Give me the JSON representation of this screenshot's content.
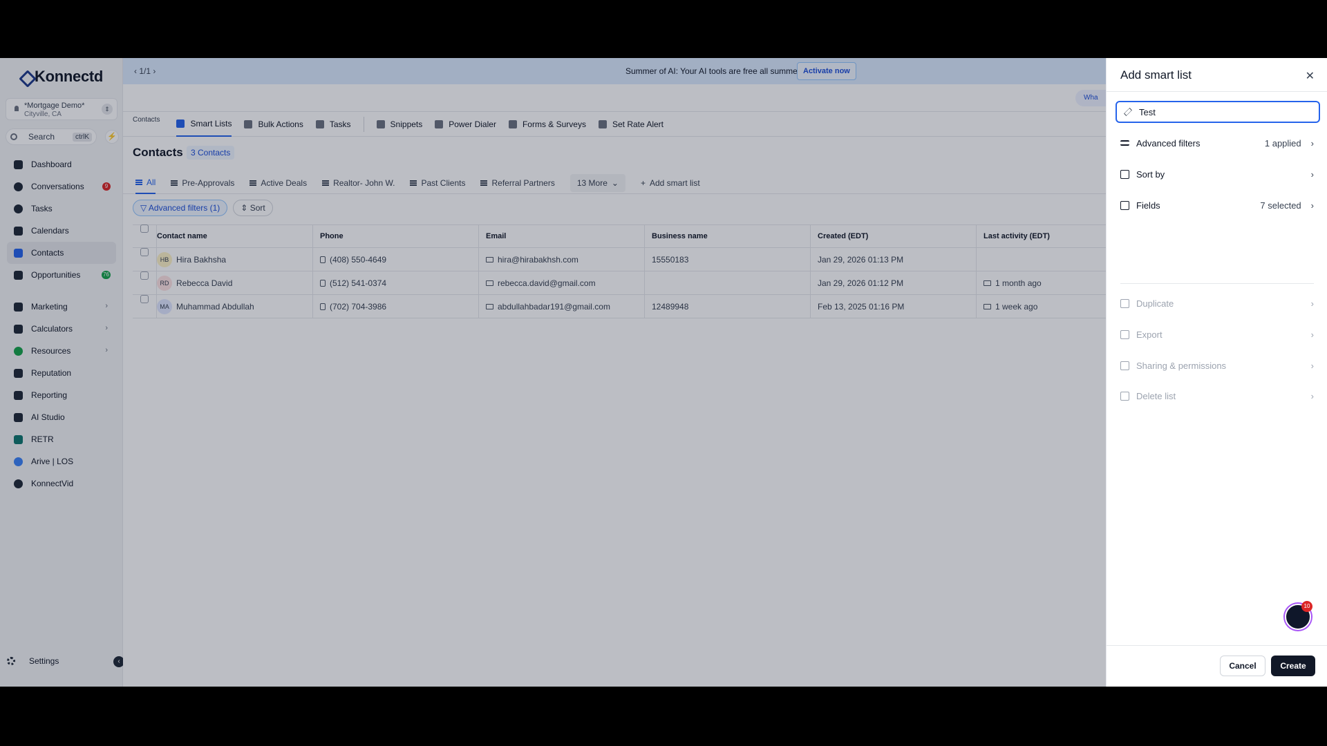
{
  "app": {
    "brand": "Konnectd"
  },
  "account": {
    "name": "*Mortgage Demo*",
    "location": "Cityville, CA"
  },
  "search": {
    "placeholder": "Search",
    "shortcut": "ctrlK"
  },
  "nav": {
    "items": [
      {
        "label": "Dashboard"
      },
      {
        "label": "Conversations",
        "badge": "9"
      },
      {
        "label": "Tasks"
      },
      {
        "label": "Calendars"
      },
      {
        "label": "Contacts"
      },
      {
        "label": "Opportunities",
        "badge": "76"
      },
      {
        "label": "Marketing"
      },
      {
        "label": "Calculators"
      },
      {
        "label": "Resources"
      },
      {
        "label": "Reputation"
      },
      {
        "label": "Reporting"
      },
      {
        "label": "AI Studio"
      },
      {
        "label": "RETR"
      },
      {
        "label": "Arive | LOS"
      },
      {
        "label": "KonnectVid"
      }
    ],
    "settings": "Settings"
  },
  "banner": {
    "pager": "1/1",
    "message": "Summer of AI: Your AI tools are free all summer.",
    "cta": "Activate now"
  },
  "topbar": {
    "whats_new": "Wha"
  },
  "subnav": {
    "crumb": "Contacts",
    "items": [
      "Smart Lists",
      "Bulk Actions",
      "Tasks",
      "Snippets",
      "Power Dialer",
      "Forms & Surveys",
      "Set Rate Alert"
    ]
  },
  "page": {
    "title": "Contacts",
    "count": "3 Contacts"
  },
  "tabs": [
    "All",
    "Pre-Approvals",
    "Active Deals",
    "Realtor- John W.",
    "Past Clients",
    "Referral Partners",
    "13 More",
    "Add smart list"
  ],
  "filters": {
    "advanced": "Advanced filters (1)",
    "sort": "Sort"
  },
  "table": {
    "headers": [
      "Contact name",
      "Phone",
      "Email",
      "Business name",
      "Created (EDT)",
      "Last activity (EDT)"
    ],
    "rows": [
      {
        "initials": "HB",
        "name": "Hira Bakhsha",
        "phone": "(408) 550-4649",
        "email": "hira@hirabakhsh.com",
        "business": "15550183",
        "created": "Jan 29, 2026 01:13 PM",
        "last": ""
      },
      {
        "initials": "RD",
        "name": "Rebecca David",
        "phone": "(512) 541-0374",
        "email": "rebecca.david@gmail.com",
        "business": "",
        "created": "Jan 29, 2026 01:12 PM",
        "last": "1 month ago"
      },
      {
        "initials": "MA",
        "name": "Muhammad Abdullah",
        "phone": "(702) 704-3986",
        "email": "abdullahbadar191@gmail.com",
        "business": "12489948",
        "created": "Feb 13, 2025 01:16 PM",
        "last": "1 week ago"
      }
    ]
  },
  "drawer": {
    "title": "Add smart list",
    "name_value": "Test",
    "rows": {
      "advanced_filters": {
        "label": "Advanced filters",
        "value": "1 applied"
      },
      "sort_by": {
        "label": "Sort by"
      },
      "fields": {
        "label": "Fields",
        "value": "7 selected"
      },
      "duplicate": {
        "label": "Duplicate"
      },
      "export": {
        "label": "Export"
      },
      "sharing": {
        "label": "Sharing & permissions"
      },
      "delete": {
        "label": "Delete list"
      }
    },
    "cancel": "Cancel",
    "create": "Create",
    "chat_badge": "10"
  },
  "colors": {
    "accent": "#2563eb",
    "primary_button": "#111827",
    "banner": "#dbeafe"
  }
}
